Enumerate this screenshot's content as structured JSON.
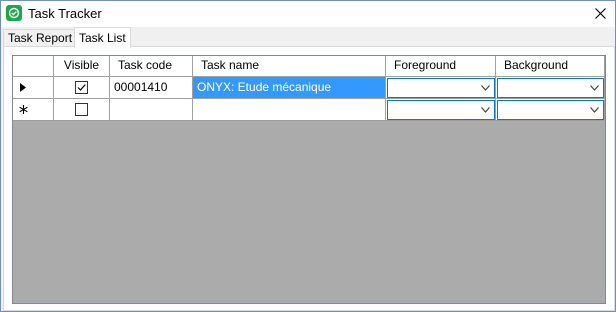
{
  "window": {
    "title": "Task Tracker"
  },
  "tabs": [
    {
      "label": "Task Report"
    },
    {
      "label": "Task List"
    }
  ],
  "grid": {
    "columns": {
      "visible": "Visible",
      "task_code": "Task code",
      "task_name": "Task name",
      "foreground": "Foreground",
      "background": "Background"
    },
    "rows": [
      {
        "visible": true,
        "task_code": "00001410",
        "task_name": "ONYX: Etude mécanique",
        "foreground": "",
        "background": ""
      },
      {
        "visible": false,
        "task_code": "",
        "task_name": "",
        "foreground": "",
        "background": ""
      }
    ],
    "row_indicators": {
      "current": "arrow-right-icon",
      "new": "asterisk-icon"
    }
  },
  "colors": {
    "selection": "#3399ff",
    "app_icon": "#18a94a"
  }
}
